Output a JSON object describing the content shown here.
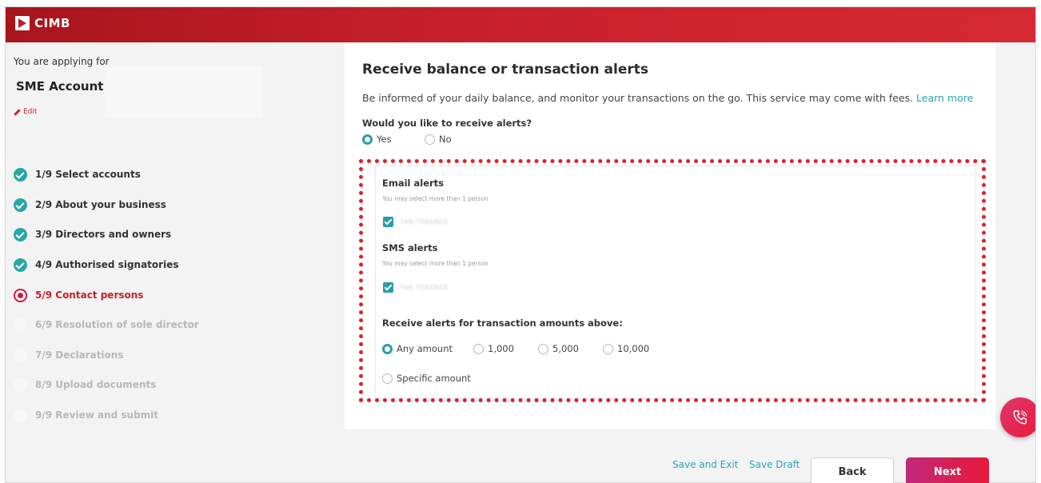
{
  "brand": {
    "name": "CIMB"
  },
  "sidebar": {
    "applying_label": "You are applying for",
    "product": "SME Account",
    "edit_label": "Edit",
    "steps": [
      {
        "label": "1/9 Select accounts",
        "state": "done"
      },
      {
        "label": "2/9 About your business",
        "state": "done"
      },
      {
        "label": "3/9 Directors and owners",
        "state": "done"
      },
      {
        "label": "4/9 Authorised signatories",
        "state": "done"
      },
      {
        "label": "5/9 Contact persons",
        "state": "current"
      },
      {
        "label": "6/9 Resolution of sole director",
        "state": "todo"
      },
      {
        "label": "7/9 Declarations",
        "state": "todo"
      },
      {
        "label": "8/9 Upload documents",
        "state": "todo"
      },
      {
        "label": "9/9 Review and submit",
        "state": "todo"
      }
    ]
  },
  "main": {
    "title": "Receive balance or transaction alerts",
    "description": "Be informed of your daily balance, and monitor your transactions on the go. This service may come with fees.",
    "learn_more": "Learn more",
    "question": "Would you like to receive alerts?",
    "options": {
      "yes": "Yes",
      "no": "No",
      "selected": "Yes"
    },
    "email_alerts": {
      "title": "Email alerts",
      "hint": "You may select more than 1 person",
      "person": "TAN TERENCE",
      "checked": true
    },
    "sms_alerts": {
      "title": "SMS alerts",
      "hint": "You may select more than 1 person",
      "person": "TAN TERENCE",
      "checked": true
    },
    "amount": {
      "title": "Receive alerts for transaction amounts above:",
      "options": [
        "Any amount",
        "1,000",
        "5,000",
        "10,000"
      ],
      "specific": "Specific amount",
      "selected": "Any amount"
    }
  },
  "footer": {
    "save_exit": "Save and Exit",
    "save_draft": "Save Draft",
    "back": "Back",
    "next": "Next"
  },
  "colors": {
    "brand_red": "#c8202b",
    "accent_teal": "#2aa5b3",
    "highlight_border": "#e01e2b"
  },
  "icons": {
    "call": "phone-call-icon"
  }
}
